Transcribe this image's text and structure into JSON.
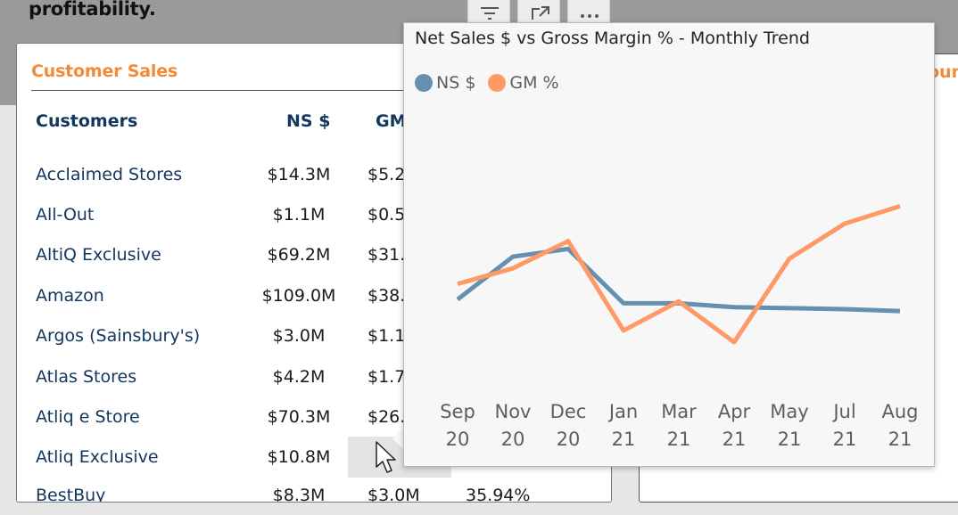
{
  "page": {
    "heading_fragment": "profitability."
  },
  "visual_header": {
    "icons": [
      "filter-icon",
      "focus-mode-icon",
      "more-options-icon"
    ]
  },
  "customer_table": {
    "title": "Customer Sales",
    "columns": [
      "Customers",
      "NS $",
      "GM"
    ],
    "rows": [
      {
        "customer": "Acclaimed Stores",
        "ns": "$14.3M",
        "gm": "$5.2"
      },
      {
        "customer": "All-Out",
        "ns": "$1.1M",
        "gm": "$0.5"
      },
      {
        "customer": "AltiQ Exclusive",
        "ns": "$69.2M",
        "gm": "$31."
      },
      {
        "customer": "Amazon",
        "ns": "$109.0M",
        "gm": "$38."
      },
      {
        "customer": "Argos (Sainsbury's)",
        "ns": "$3.0M",
        "gm": "$1.1"
      },
      {
        "customer": "Atlas Stores",
        "ns": "$4.2M",
        "gm": "$1.7"
      },
      {
        "customer": "Atliq e Store",
        "ns": "$70.3M",
        "gm": "$26."
      },
      {
        "customer": "Atliq Exclusive",
        "ns": "$10.8M",
        "gm": ""
      },
      {
        "customer": "BestBuy",
        "ns": "$8.3M",
        "gm": "$3.0M",
        "gm_pct": "35.94%"
      }
    ]
  },
  "right_visual": {
    "title_fragment": "oun"
  },
  "tooltip": {
    "title": "Net Sales $ vs Gross Margin % - Monthly Trend",
    "legend": [
      {
        "label": "NS $",
        "color": "#6590b0"
      },
      {
        "label": "GM %",
        "color": "#ff9966"
      }
    ]
  },
  "chart_data": {
    "type": "line",
    "title": "Net Sales $ vs Gross Margin % - Monthly Trend",
    "x": [
      {
        "month": "Sep",
        "year": "20"
      },
      {
        "month": "Nov",
        "year": "20"
      },
      {
        "month": "Dec",
        "year": "20"
      },
      {
        "month": "Jan",
        "year": "21"
      },
      {
        "month": "Mar",
        "year": "21"
      },
      {
        "month": "Apr",
        "year": "21"
      },
      {
        "month": "May",
        "year": "21"
      },
      {
        "month": "Jul",
        "year": "21"
      },
      {
        "month": "Aug",
        "year": "21"
      }
    ],
    "axes_visible": false,
    "grid": false,
    "legend_position": "top-left",
    "series": [
      {
        "name": "NS $",
        "color": "#6590b0",
        "values": [
          0.78,
          0.56,
          0.52,
          0.8,
          0.8,
          0.82,
          0.825,
          0.83,
          0.84
        ]
      },
      {
        "name": "GM %",
        "color": "#ff9966",
        "values": [
          0.7,
          0.62,
          0.48,
          0.94,
          0.79,
          1.0,
          0.57,
          0.39,
          0.3
        ]
      }
    ]
  }
}
